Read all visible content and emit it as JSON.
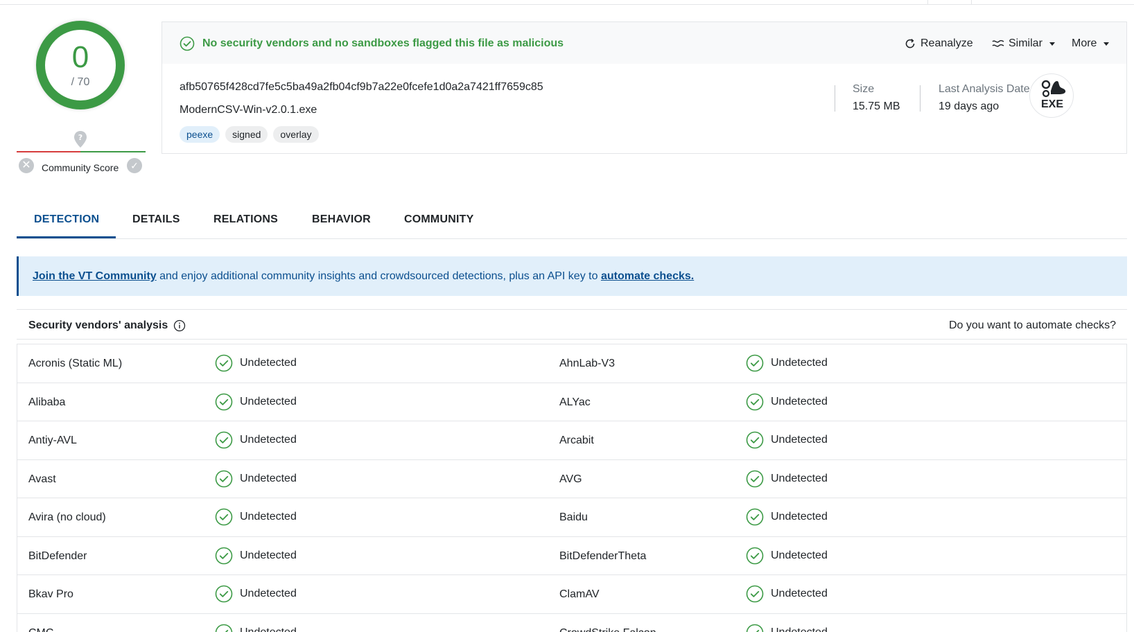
{
  "score": {
    "detections": "0",
    "total": "/ 70"
  },
  "community": {
    "label": "Community Score"
  },
  "status": {
    "message": "No security vendors and no sandboxes flagged this file as malicious"
  },
  "actions": {
    "reanalyze": "Reanalyze",
    "similar": "Similar",
    "more": "More"
  },
  "file": {
    "hash": "afb50765f428cd7fe5c5ba49a2fb04cf9b7a22e0fcefe1d0a2a7421ff7659c85",
    "name": "ModernCSV-Win-v2.0.1.exe",
    "tags": [
      "peexe",
      "signed",
      "overlay"
    ],
    "size_label": "Size",
    "size_value": "15.75 MB",
    "date_label": "Last Analysis Date",
    "date_value": "19 days ago",
    "type": "EXE"
  },
  "tabs": [
    "DETECTION",
    "DETAILS",
    "RELATIONS",
    "BEHAVIOR",
    "COMMUNITY"
  ],
  "banner": {
    "link1": "Join the VT Community",
    "middle": " and enjoy additional community insights and crowdsourced detections, plus an API key to ",
    "link2": "automate checks."
  },
  "analysis": {
    "title": "Security vendors' analysis",
    "automate_prompt": "Do you want to automate checks?",
    "rows": [
      {
        "left": "Acronis (Static ML)",
        "left_status": "Undetected",
        "right": "AhnLab-V3",
        "right_status": "Undetected"
      },
      {
        "left": "Alibaba",
        "left_status": "Undetected",
        "right": "ALYac",
        "right_status": "Undetected"
      },
      {
        "left": "Antiy-AVL",
        "left_status": "Undetected",
        "right": "Arcabit",
        "right_status": "Undetected"
      },
      {
        "left": "Avast",
        "left_status": "Undetected",
        "right": "AVG",
        "right_status": "Undetected"
      },
      {
        "left": "Avira (no cloud)",
        "left_status": "Undetected",
        "right": "Baidu",
        "right_status": "Undetected"
      },
      {
        "left": "BitDefender",
        "left_status": "Undetected",
        "right": "BitDefenderTheta",
        "right_status": "Undetected"
      },
      {
        "left": "Bkav Pro",
        "left_status": "Undetected",
        "right": "ClamAV",
        "right_status": "Undetected"
      },
      {
        "left": "CMC",
        "left_status": "Undetected",
        "right": "CrowdStrike Falcon",
        "right_status": "Undetected"
      }
    ]
  },
  "colors": {
    "green": "#3c9a45",
    "blue": "#0b4f8f",
    "banner_bg": "#e1effa",
    "red": "#d63c3c"
  },
  "icons": {
    "status": "check-circle-icon",
    "reanalyze": "refresh-icon",
    "similar": "similar-icon",
    "file_type": "exe-gears-icon",
    "info": "info-icon",
    "community_pin": "map-pin-question-icon"
  }
}
